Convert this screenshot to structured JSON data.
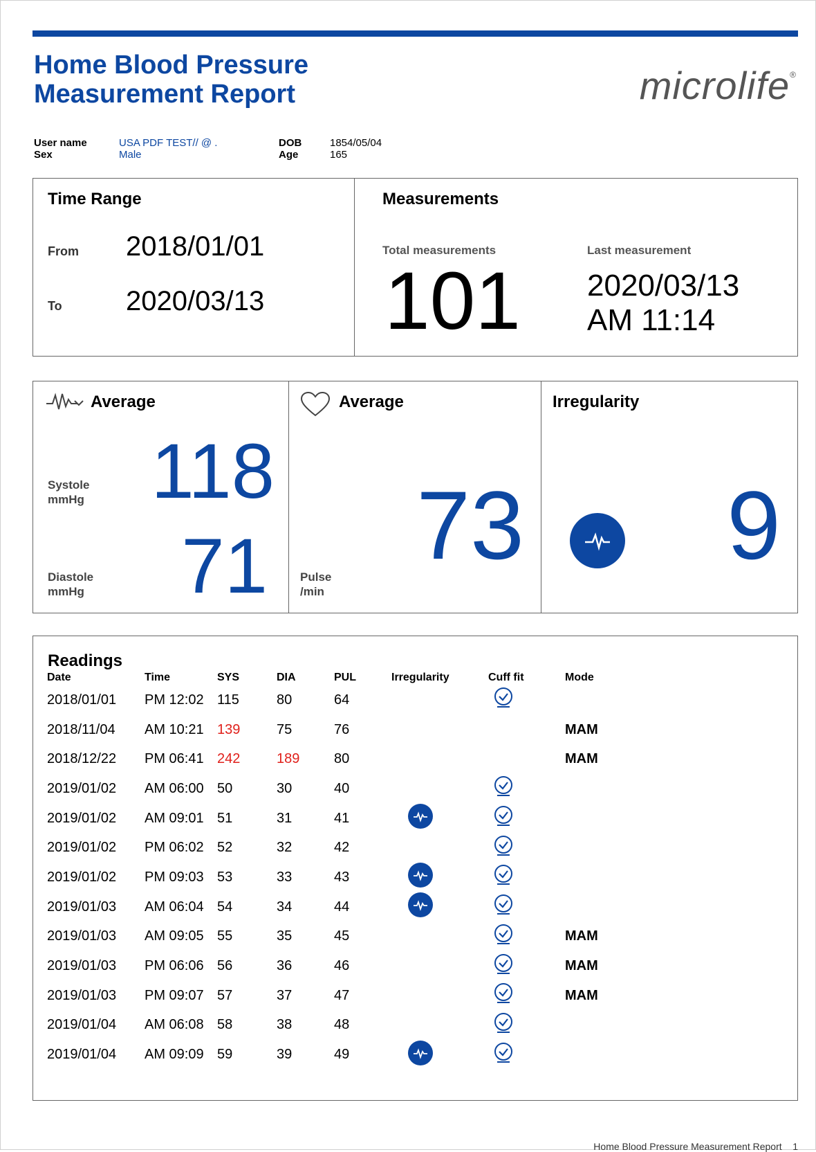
{
  "report": {
    "title_line1": "Home Blood Pressure",
    "title_line2": "Measurement Report",
    "logo_text": "microlife",
    "logo_mark": "®",
    "accent_color": "#0d47a1",
    "alert_color": "#e0201b"
  },
  "user": {
    "name_label": "User name",
    "name": "USA PDF TEST// @ .",
    "sex_label": "Sex",
    "sex": "Male",
    "dob_label": "DOB",
    "dob": "1854/05/04",
    "age_label": "Age",
    "age": "165"
  },
  "time_range": {
    "heading": "Time Range",
    "from_label": "From",
    "from": "2018/01/01",
    "to_label": "To",
    "to": "2020/03/13"
  },
  "measurements": {
    "heading": "Measurements",
    "total_label": "Total measurements",
    "total": "101",
    "last_label": "Last measurement",
    "last_date": "2020/03/13",
    "last_time": "AM 11:14"
  },
  "bp_average": {
    "icon": "pulse-wave-icon",
    "heading": "Average",
    "systole_label": "Systole",
    "systole_unit": "mmHg",
    "systole": "118",
    "diastole_label": "Diastole",
    "diastole_unit": "mmHg",
    "diastole": "71"
  },
  "pulse_average": {
    "icon": "heart-icon",
    "heading": "Average",
    "pulse_label": "Pulse",
    "pulse_unit": "/min",
    "pulse": "73"
  },
  "irregularity": {
    "icon": "irregular-heartbeat-icon",
    "heading": "Irregularity",
    "count": "9"
  },
  "readings": {
    "heading": "Readings",
    "columns": [
      "Date",
      "Time",
      "SYS",
      "DIA",
      "PUL",
      "Irregularity",
      "Cuff fit",
      "Mode"
    ],
    "rows": [
      {
        "date": "2018/01/01",
        "time": "PM 12:02",
        "sys": "115",
        "dia": "80",
        "pul": "64",
        "irr": false,
        "cuff": true,
        "mode": "",
        "sys_alert": false,
        "dia_alert": false
      },
      {
        "date": "2018/11/04",
        "time": "AM 10:21",
        "sys": "139",
        "dia": "75",
        "pul": "76",
        "irr": false,
        "cuff": false,
        "mode": "MAM",
        "sys_alert": true,
        "dia_alert": false
      },
      {
        "date": "2018/12/22",
        "time": "PM 06:41",
        "sys": "242",
        "dia": "189",
        "pul": "80",
        "irr": false,
        "cuff": false,
        "mode": "MAM",
        "sys_alert": true,
        "dia_alert": true
      },
      {
        "date": "2019/01/02",
        "time": "AM 06:00",
        "sys": "50",
        "dia": "30",
        "pul": "40",
        "irr": false,
        "cuff": true,
        "mode": "",
        "sys_alert": false,
        "dia_alert": false
      },
      {
        "date": "2019/01/02",
        "time": "AM 09:01",
        "sys": "51",
        "dia": "31",
        "pul": "41",
        "irr": true,
        "cuff": true,
        "mode": "",
        "sys_alert": false,
        "dia_alert": false
      },
      {
        "date": "2019/01/02",
        "time": "PM 06:02",
        "sys": "52",
        "dia": "32",
        "pul": "42",
        "irr": false,
        "cuff": true,
        "mode": "",
        "sys_alert": false,
        "dia_alert": false
      },
      {
        "date": "2019/01/02",
        "time": "PM 09:03",
        "sys": "53",
        "dia": "33",
        "pul": "43",
        "irr": true,
        "cuff": true,
        "mode": "",
        "sys_alert": false,
        "dia_alert": false
      },
      {
        "date": "2019/01/03",
        "time": "AM 06:04",
        "sys": "54",
        "dia": "34",
        "pul": "44",
        "irr": true,
        "cuff": true,
        "mode": "",
        "sys_alert": false,
        "dia_alert": false
      },
      {
        "date": "2019/01/03",
        "time": "AM 09:05",
        "sys": "55",
        "dia": "35",
        "pul": "45",
        "irr": false,
        "cuff": true,
        "mode": "MAM",
        "sys_alert": false,
        "dia_alert": false
      },
      {
        "date": "2019/01/03",
        "time": "PM 06:06",
        "sys": "56",
        "dia": "36",
        "pul": "46",
        "irr": false,
        "cuff": true,
        "mode": "MAM",
        "sys_alert": false,
        "dia_alert": false
      },
      {
        "date": "2019/01/03",
        "time": "PM 09:07",
        "sys": "57",
        "dia": "37",
        "pul": "47",
        "irr": false,
        "cuff": true,
        "mode": "MAM",
        "sys_alert": false,
        "dia_alert": false
      },
      {
        "date": "2019/01/04",
        "time": "AM 06:08",
        "sys": "58",
        "dia": "38",
        "pul": "48",
        "irr": false,
        "cuff": true,
        "mode": "",
        "sys_alert": false,
        "dia_alert": false
      },
      {
        "date": "2019/01/04",
        "time": "AM 09:09",
        "sys": "59",
        "dia": "39",
        "pul": "49",
        "irr": true,
        "cuff": true,
        "mode": "",
        "sys_alert": false,
        "dia_alert": false
      }
    ]
  },
  "footer": {
    "text": "Home Blood Pressure Measurement Report",
    "page": "1"
  }
}
